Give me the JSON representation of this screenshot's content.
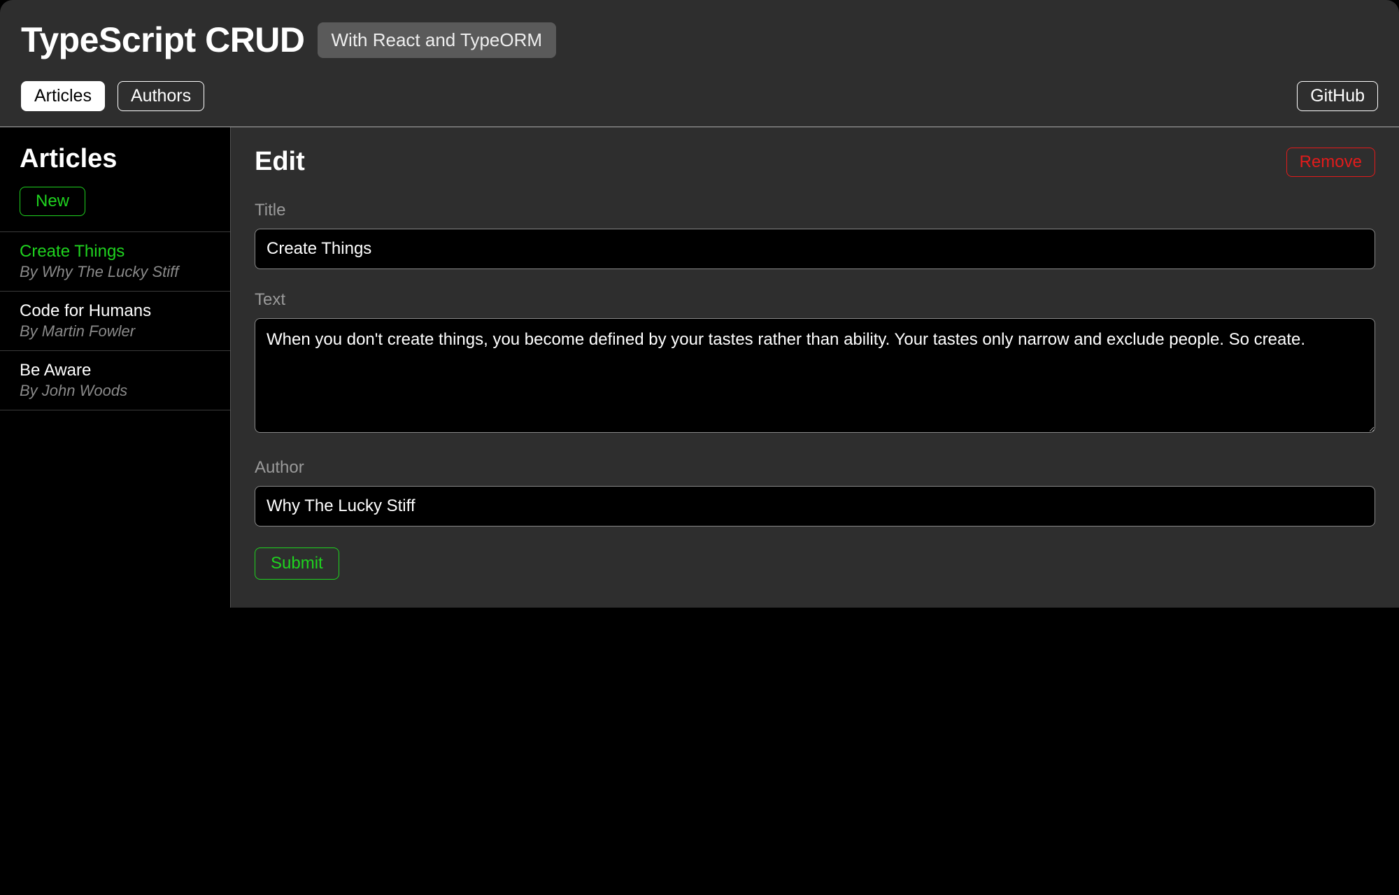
{
  "header": {
    "title": "TypeScript CRUD",
    "subtitle": "With React and TypeORM",
    "nav": {
      "articles": "Articles",
      "authors": "Authors",
      "github": "GitHub"
    }
  },
  "sidebar": {
    "title": "Articles",
    "new_label": "New",
    "items": [
      {
        "title": "Create Things",
        "author_line": "By Why The Lucky Stiff",
        "active": true
      },
      {
        "title": "Code for Humans",
        "author_line": "By Martin Fowler",
        "active": false
      },
      {
        "title": "Be Aware",
        "author_line": "By John Woods",
        "active": false
      }
    ]
  },
  "main": {
    "heading": "Edit",
    "remove_label": "Remove",
    "fields": {
      "title_label": "Title",
      "title_value": "Create Things",
      "text_label": "Text",
      "text_value": "When you don't create things, you become defined by your tastes rather than ability. Your tastes only narrow and exclude people. So create.",
      "author_label": "Author",
      "author_value": "Why The Lucky Stiff"
    },
    "submit_label": "Submit"
  },
  "colors": {
    "accent_green": "#1fd31f",
    "accent_red": "#e21b1b",
    "panel_bg": "#2e2e2e",
    "input_bg": "#000000"
  }
}
